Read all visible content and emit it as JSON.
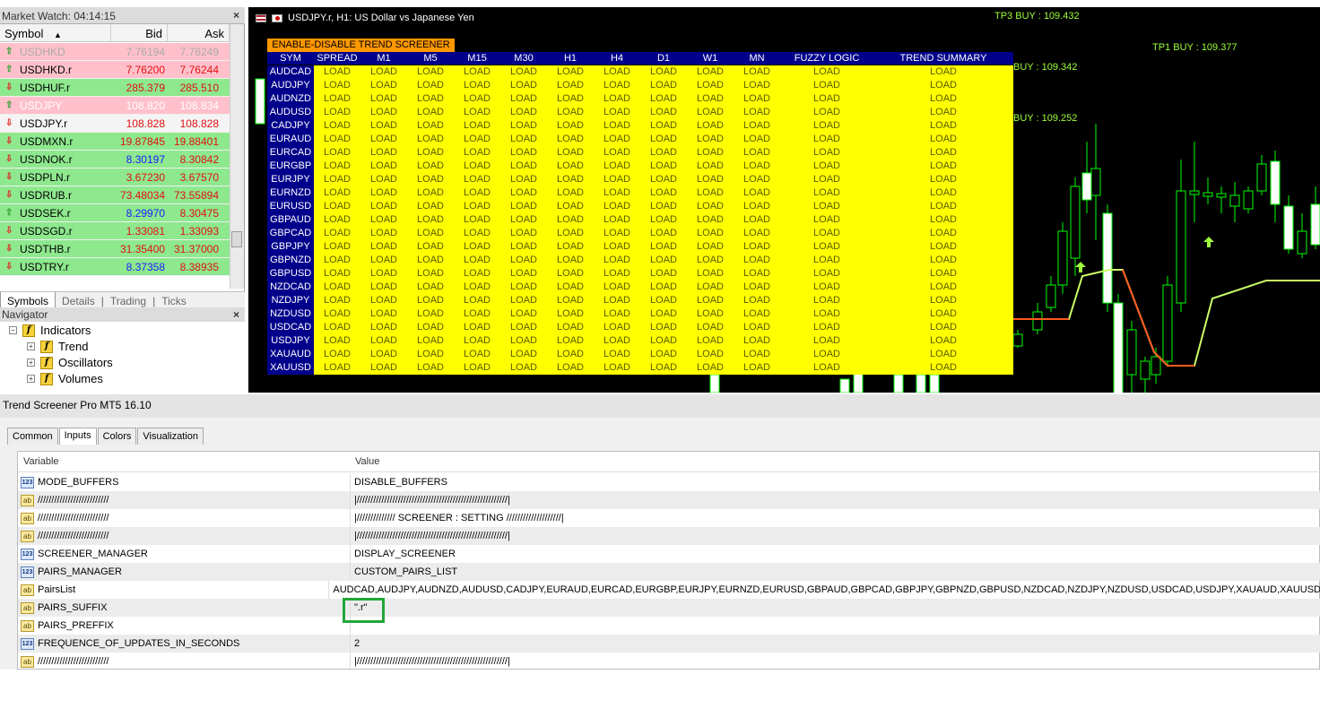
{
  "market_watch": {
    "title": "Market Watch: 04:14:15",
    "close": "×",
    "headers": {
      "symbol": "Symbol",
      "sort": "▲",
      "bid": "Bid",
      "ask": "Ask"
    },
    "rows": [
      {
        "symbol": "USDHKD",
        "bid": "7.76194",
        "ask": "7.76249",
        "bg": "#ffc0cb",
        "fg": "#aaaaaa",
        "dir": "up"
      },
      {
        "symbol": "USDHKD.r",
        "bid": "7.76200",
        "ask": "7.76244",
        "bg": "#ffc0cb",
        "fg": "#000000",
        "dir": "up"
      },
      {
        "symbol": "USDHUF.r",
        "bid": "285.379",
        "ask": "285.510",
        "bg": "#8ee88e",
        "fg": "#000000",
        "dir": "down"
      },
      {
        "symbol": "USDJPY",
        "bid": "108.820",
        "ask": "108.834",
        "bg": "#ffc0cb",
        "fg": "#ffffff",
        "dir": "up"
      },
      {
        "symbol": "USDJPY.r",
        "bid": "108.828",
        "ask": "108.828",
        "bg": "#f4f4f4",
        "fg": "#000000",
        "dir": "down"
      },
      {
        "symbol": "USDMXN.r",
        "bid": "19.87845",
        "ask": "19.88401",
        "bg": "#8ee88e",
        "fg": "#000000",
        "dir": "down"
      },
      {
        "symbol": "USDNOK.r",
        "bid": "8.30197",
        "ask": "8.30842",
        "bg": "#8ee88e",
        "fg": "#000000",
        "dir": "down"
      },
      {
        "symbol": "USDPLN.r",
        "bid": "3.67230",
        "ask": "3.67570",
        "bg": "#8ee88e",
        "fg": "#000000",
        "dir": "down"
      },
      {
        "symbol": "USDRUB.r",
        "bid": "73.48034",
        "ask": "73.55894",
        "bg": "#8ee88e",
        "fg": "#000000",
        "dir": "down"
      },
      {
        "symbol": "USDSEK.r",
        "bid": "8.29970",
        "ask": "8.30475",
        "bg": "#8ee88e",
        "fg": "#000000",
        "dir": "up"
      },
      {
        "symbol": "USDSGD.r",
        "bid": "1.33081",
        "ask": "1.33093",
        "bg": "#8ee88e",
        "fg": "#000000",
        "dir": "down"
      },
      {
        "symbol": "USDTHB.r",
        "bid": "31.35400",
        "ask": "31.37000",
        "bg": "#8ee88e",
        "fg": "#000000",
        "dir": "down"
      },
      {
        "symbol": "USDTRY.r",
        "bid": "8.37358",
        "ask": "8.38935",
        "bg": "#8ee88e",
        "fg": "#000000",
        "dir": "down"
      }
    ],
    "tabs": [
      "Symbols",
      "Details",
      "Trading",
      "Ticks"
    ],
    "tab_sep": "|"
  },
  "navigator": {
    "title": "Navigator",
    "close": "×",
    "items": [
      "Indicators",
      "Trend",
      "Oscillators",
      "Volumes"
    ],
    "icon_letter": "f"
  },
  "chart": {
    "title": "USDJPY.r, H1:  US Dollar vs Japanese Yen",
    "tp3": "TP3 BUY : 109.432",
    "tp1": "TP1 BUY : 109.377",
    "buy1": "BUY : 109.342",
    "buy2": "BUY : 109.252",
    "screener_button": "ENABLE-DISABLE TREND SCREENER",
    "headers": [
      "SYM",
      "SPREAD",
      "M1",
      "M5",
      "M15",
      "M30",
      "H1",
      "H4",
      "D1",
      "W1",
      "MN",
      "FUZZY LOGIC",
      "TREND SUMMARY"
    ],
    "symbols": [
      "AUDCAD",
      "AUDJPY",
      "AUDNZD",
      "AUDUSD",
      "CADJPY",
      "EURAUD",
      "EURCAD",
      "EURGBP",
      "EURJPY",
      "EURNZD",
      "EURUSD",
      "GBPAUD",
      "GBPCAD",
      "GBPJPY",
      "GBPNZD",
      "GBPUSD",
      "NZDCAD",
      "NZDJPY",
      "NZDUSD",
      "USDCAD",
      "USDJPY",
      "XAUAUD",
      "XAUUSD"
    ],
    "cell_value": "LOAD",
    "colors": {
      "header": "#00008b",
      "cell": "#ffff00",
      "button": "#ff9800",
      "up_line": "#ccff66",
      "down_line": "#ff5a1f"
    }
  },
  "dialog": {
    "title": "Trend Screener Pro MT5 16.10",
    "tabs": [
      "Common",
      "Inputs",
      "Colors",
      "Visualization"
    ],
    "columns": {
      "variable": "Variable",
      "value": "Value"
    },
    "icon_num": "123",
    "icon_text": "ab",
    "rows": [
      {
        "icon": "123",
        "var": "MODE_BUFFERS",
        "val": "DISABLE_BUFFERS"
      },
      {
        "icon": "ab",
        "var": "//////////////////////////",
        "val": "|///////////////////////////////////////////////////////|"
      },
      {
        "icon": "ab",
        "var": "//////////////////////////",
        "val": "|////////////// SCREENER : SETTING ////////////////////|"
      },
      {
        "icon": "ab",
        "var": "//////////////////////////",
        "val": "|///////////////////////////////////////////////////////|"
      },
      {
        "icon": "123",
        "var": "SCREENER_MANAGER",
        "val": "DISPLAY_SCREENER"
      },
      {
        "icon": "123",
        "var": "PAIRS_MANAGER",
        "val": "CUSTOM_PAIRS_LIST"
      },
      {
        "icon": "ab",
        "var": "PairsList",
        "val": "AUDCAD,AUDJPY,AUDNZD,AUDUSD,CADJPY,EURAUD,EURCAD,EURGBP,EURJPY,EURNZD,EURUSD,GBPAUD,GBPCAD,GBPJPY,GBPNZD,GBPUSD,NZDCAD,NZDJPY,NZDUSD,USDCAD,USDJPY,XAUAUD,XAUUSD"
      },
      {
        "icon": "ab",
        "var": "PAIRS_SUFFIX",
        "val": "\".r\""
      },
      {
        "icon": "ab",
        "var": "PAIRS_PREFFIX",
        "val": ""
      },
      {
        "icon": "123",
        "var": "FREQUENCE_OF_UPDATES_IN_SECONDS",
        "val": "2"
      },
      {
        "icon": "ab",
        "var": "//////////////////////////",
        "val": "|///////////////////////////////////////////////////////|"
      }
    ]
  }
}
